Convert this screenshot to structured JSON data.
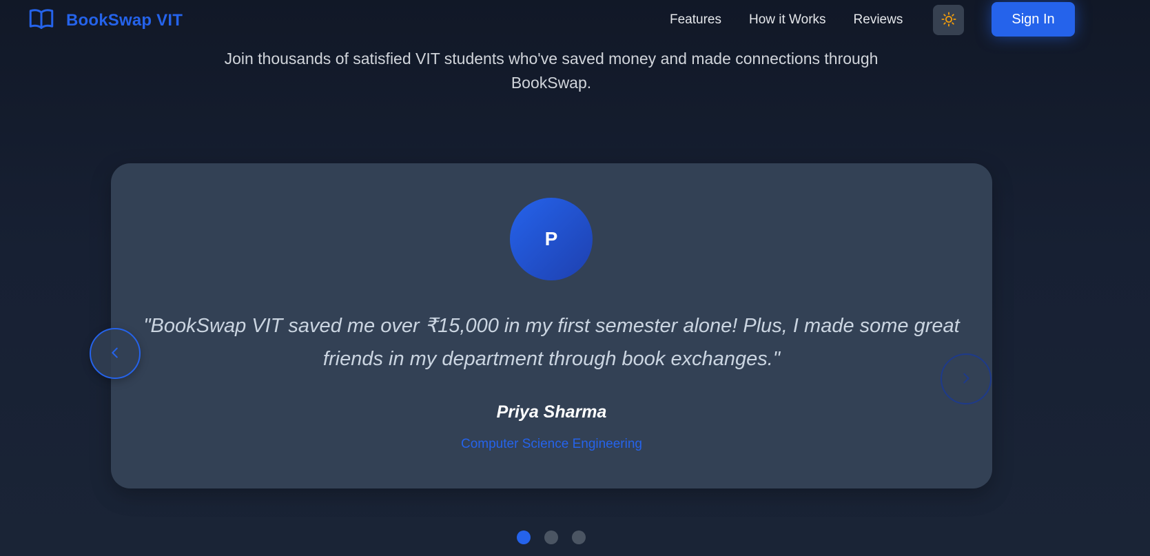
{
  "brand": {
    "name": "BookSwap VIT",
    "icon": "book-open-icon",
    "color": "#2563eb"
  },
  "nav": {
    "links": [
      "Features",
      "How it Works",
      "Reviews"
    ],
    "theme_toggle_icon": "sun-icon",
    "sign_in_label": "Sign In"
  },
  "section": {
    "subtitle": "Join thousands of satisfied VIT students who've saved money and made connections through BookSwap."
  },
  "testimonial": {
    "avatar_initial": "P",
    "quote": "\"BookSwap VIT saved me over ₹15,000 in my first semester alone! Plus, I made some great friends in my department through book exchanges.\"",
    "author": "Priya Sharma",
    "department": "Computer Science Engineering"
  },
  "carousel": {
    "prev_icon": "chevron-left-icon",
    "next_icon": "chevron-right-icon",
    "active_index": 0,
    "dot_count": 3
  },
  "colors": {
    "accent": "#2563eb",
    "card": "#334155",
    "dot_inactive": "#4b5563",
    "sun": "#f59e0b"
  }
}
